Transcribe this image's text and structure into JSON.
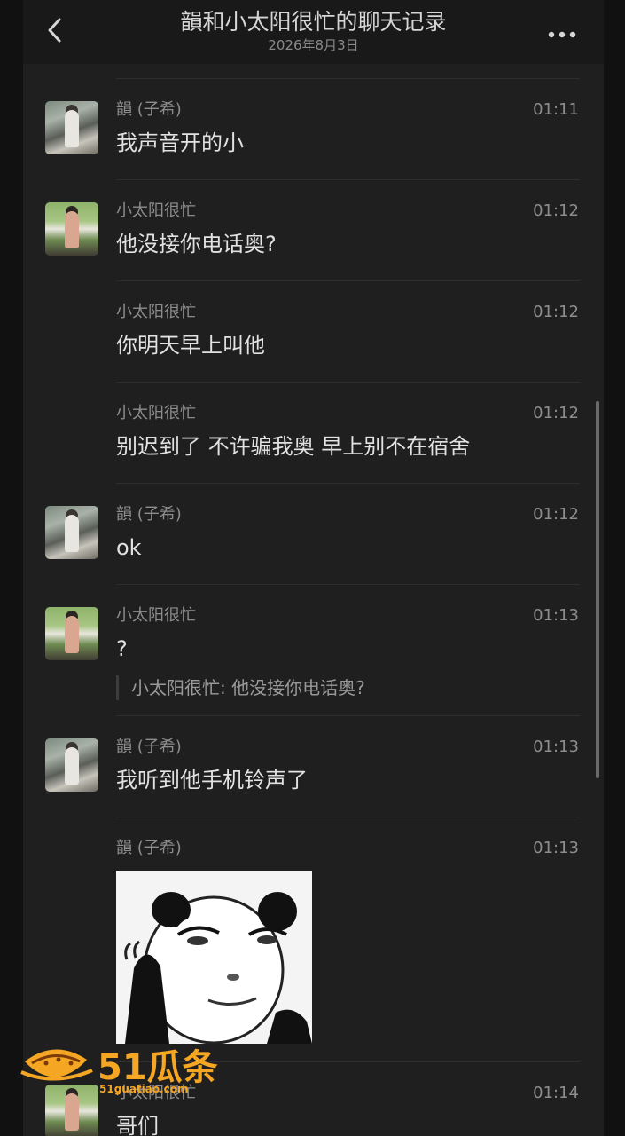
{
  "header": {
    "title": "韻和小太阳很忙的聊天记录",
    "date": "2026年8月3日",
    "back_icon": "chevron-left-icon",
    "more_icon": "more-dots-icon"
  },
  "messages": [
    {
      "sender": "韻 (子希)",
      "time": "01:11",
      "text": "我声音开的小"
    },
    {
      "sender": "小太阳很忙",
      "time": "01:12",
      "text": "他没接你电话奥?"
    },
    {
      "sender": "小太阳很忙",
      "time": "01:12",
      "text": "你明天早上叫他"
    },
    {
      "sender": "小太阳很忙",
      "time": "01:12",
      "text": "别迟到了 不许骗我奥 早上别不在宿舍"
    },
    {
      "sender": "韻 (子希)",
      "time": "01:12",
      "text": "ok"
    },
    {
      "sender": "小太阳很忙",
      "time": "01:13",
      "text": "?",
      "quote": "小太阳很忙: 他没接你电话奥?"
    },
    {
      "sender": "韻 (子希)",
      "time": "01:13",
      "text": "我听到他手机铃声了"
    },
    {
      "sender": "韻 (子希)",
      "time": "01:13",
      "image": "panda-meme-sticker"
    },
    {
      "sender": "小太阳很忙",
      "time": "01:14",
      "text": "哥们"
    }
  ],
  "watermark": {
    "logo": "51瓜条",
    "url": "51guatiao.com"
  },
  "colors": {
    "background": "#1f1f1f",
    "header": "#191919",
    "text": "#e2e2e2",
    "meta": "#8d8d8d",
    "watermark": "#f5a623"
  }
}
